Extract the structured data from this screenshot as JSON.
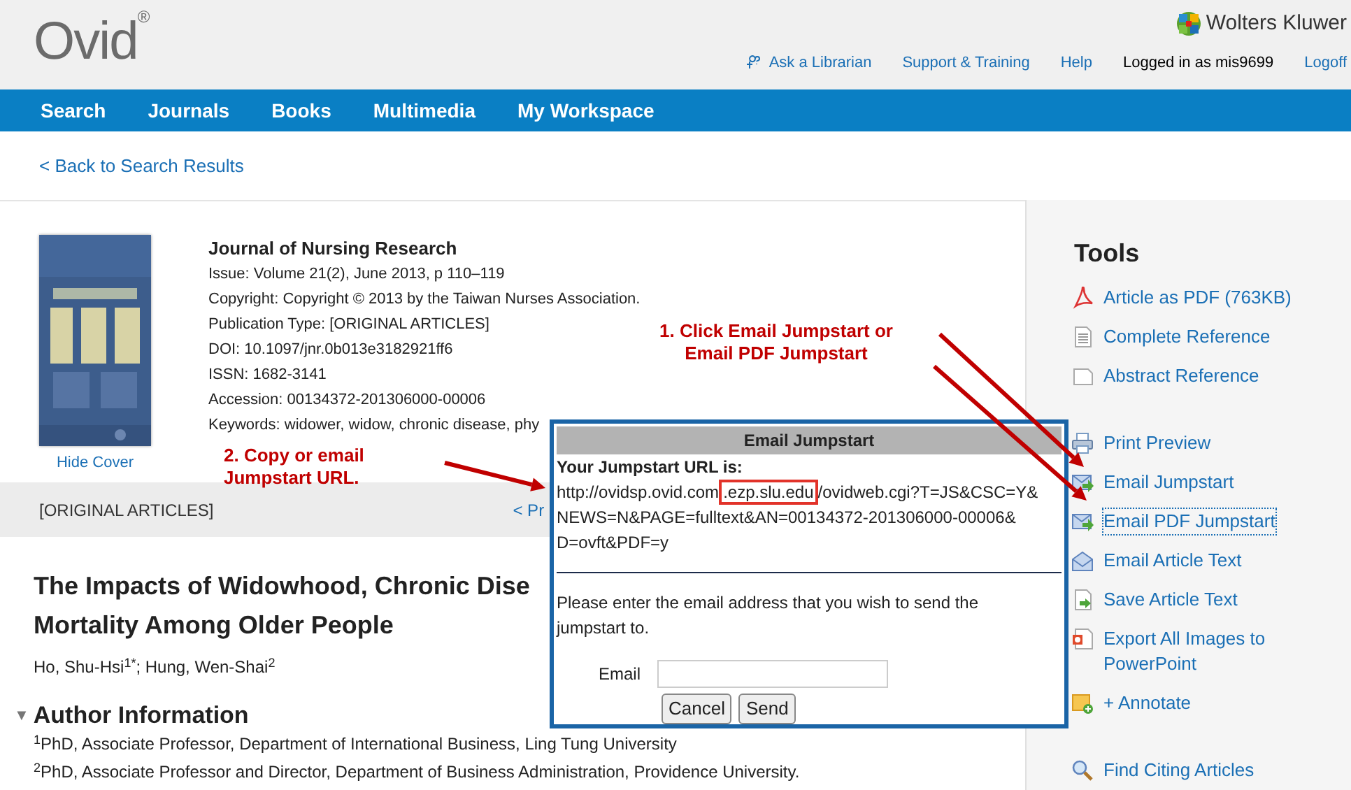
{
  "header": {
    "logo": "Ovid",
    "logo_mark": "®",
    "brand": "Wolters Kluwer",
    "links": [
      {
        "label": "Ask a Librarian",
        "kind": "librarian"
      },
      {
        "label": "Support & Training",
        "kind": "link"
      },
      {
        "label": "Help",
        "kind": "link"
      },
      {
        "label": "Logged in as mis9699",
        "kind": "status"
      },
      {
        "label": "Logoff",
        "kind": "link"
      }
    ]
  },
  "nav": [
    "Search",
    "Journals",
    "Books",
    "Multimedia",
    "My Workspace"
  ],
  "back_link": "< Back to Search Results",
  "journal": {
    "hide_cover": "Hide Cover",
    "title": "Journal of Nursing Research",
    "details": [
      "Issue: Volume 21(2), June 2013, p 110–119",
      "Copyright: Copyright © 2013 by the Taiwan Nurses Association.",
      "Publication Type: [ORIGINAL ARTICLES]",
      "DOI: 10.1097/jnr.0b013e3182921ff6",
      "ISSN: 1682-3141",
      "Accession: 00134372-201306000-00006",
      "Keywords: widower, widow, chronic disease, phy"
    ]
  },
  "section_bar": {
    "label": "[ORIGINAL ARTICLES]",
    "link": "< Pr"
  },
  "article": {
    "title_lines": [
      "The Impacts of Widowhood, Chronic Dise",
      "Mortality Among Older People"
    ],
    "authors": "Ho, Shu-Hsi$^{1*}$; Hung, Wen-Shai$^{2}$",
    "author_info": {
      "toggle": "▼",
      "heading": "Author Information",
      "expanded": true,
      "lines": [
        "$^{1}$PhD, Associate Professor, Department of International Business, Ling Tung University",
        "$^{2}$PhD, Associate Professor and Director, Department of Business Administration, Providence University."
      ]
    }
  },
  "tools": {
    "heading": "Tools",
    "groups": [
      [
        {
          "label": "Article as PDF (763KB)",
          "kind": "pdf",
          "focused": false
        },
        {
          "label": "Complete Reference",
          "kind": "document",
          "focused": false
        },
        {
          "label": "Abstract Reference",
          "kind": "page",
          "focused": false
        }
      ],
      [
        {
          "label": "Print Preview",
          "kind": "print",
          "focused": false
        },
        {
          "label": "Email Jumpstart",
          "kind": "emailsend",
          "focused": false
        },
        {
          "label": "Email PDF Jumpstart",
          "kind": "emailsend",
          "focused": true
        },
        {
          "label": "Email Article Text",
          "kind": "envelope",
          "focused": false
        },
        {
          "label": "Save Article Text",
          "kind": "save",
          "focused": false
        },
        {
          "label": "Export All Images to PowerPoint",
          "kind": "slides",
          "focused": false
        },
        {
          "label": "+ Annotate",
          "kind": "note",
          "focused": false
        }
      ],
      [
        {
          "label": "Find Citing Articles",
          "kind": "search",
          "focused": false
        }
      ]
    ]
  },
  "annotations": [
    {
      "lines": [
        "1. Click Email Jumpstart or",
        "Email PDF Jumpstart"
      ]
    },
    {
      "lines": [
        "2. Copy or email",
        "Jumpstart URL."
      ]
    }
  ],
  "dialog": {
    "title": "Email Jumpstart",
    "url_label": "Your Jumpstart URL is:",
    "url_lines": [
      [
        {
          "text": "http://ovidsp.ovid.com",
          "highlighted": false
        },
        {
          "text": ".ezp.slu.edu",
          "highlighted": true
        },
        {
          "text": "/ovidweb.cgi?T=JS&CSC=Y&",
          "highlighted": false
        }
      ],
      [
        {
          "text": "NEWS=N&PAGE=fulltext&AN=00134372-201306000-00006&",
          "highlighted": false
        }
      ],
      [
        {
          "text": "D=ovft&PDF=y",
          "highlighted": false
        }
      ]
    ],
    "prompt": "Please enter the email address that you wish to send the jumpstart to.",
    "email_label": "Email",
    "buttons": [
      "Cancel",
      "Send"
    ]
  }
}
